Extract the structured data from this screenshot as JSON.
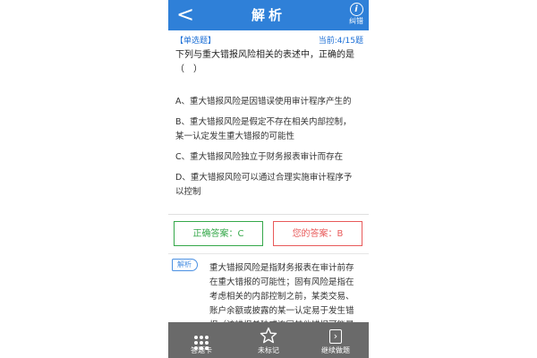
{
  "header": {
    "back_glyph": "<",
    "title": "解析",
    "report_icon": "i",
    "report_label": "纠错"
  },
  "question": {
    "type_label": "【单选题】",
    "progress_label": "当前:4/15题",
    "text": "下列与重大错报风险相关的表述中，正确的是（　）",
    "options": [
      "A、重大错报风险是因错误使用审计程序产生的",
      "B、重大错报风险是假定不存在相关内部控制，某一认定发生重大错报的可能性",
      "C、重大错报风险独立于财务报表审计而存在",
      "D、重大错报风险可以通过合理实施审计程序予以控制"
    ]
  },
  "answers": {
    "correct_label": "正确答案：C",
    "yours_label": "您的答案：B",
    "correct_color": "#35a84a",
    "yours_color": "#e85a5a"
  },
  "analysis": {
    "tag": "解析",
    "text": "重大错报风险是指财务报表在审计前存在重大错报的可能性；固有风险是指在考虑相关的内部控制之前，某类交易、账户余额或披露的某一认定易于发生错报（该错报单独或连同其他错报可能是重大的）的可能性。"
  },
  "bottom_bar": {
    "items": [
      {
        "label": "答题卡",
        "icon": "grid-icon"
      },
      {
        "label": "未标记",
        "icon": "star-icon"
      },
      {
        "label": "继续做题",
        "icon": "next-icon"
      }
    ],
    "background": "#6a6a6a"
  },
  "colors": {
    "accent": "#2f80d8",
    "link_blue": "#1c6fd6"
  }
}
